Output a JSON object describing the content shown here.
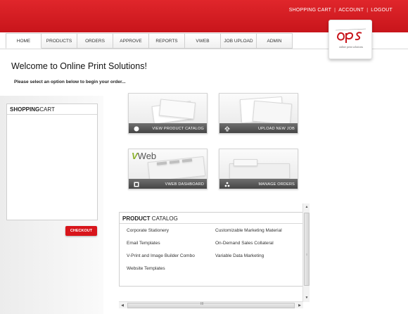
{
  "header": {
    "links": [
      "SHOPPING CART",
      "ACCOUNT",
      "LOGOUT"
    ],
    "brand_color": "#d8151b"
  },
  "nav": {
    "tabs": [
      "HOME",
      "PRODUCTS",
      "ORDERS",
      "APPROVE",
      "REPORTS",
      "VWEB",
      "JOB UPLOAD",
      "ADMIN"
    ],
    "active": "HOME"
  },
  "logo": {
    "mark": "ops",
    "tagline": "online print solutions"
  },
  "main": {
    "welcome": "Welcome to Online Print Solutions!",
    "instruction": "Please select an option below to begin your order..."
  },
  "sidebar": {
    "cart_title_bold": "SHOPPING",
    "cart_title_rest": "CART",
    "checkout_label": "CHECKOUT"
  },
  "tiles": [
    {
      "label": "VIEW PRODUCT CATALOG",
      "icon": "circle-icon"
    },
    {
      "label": "UPLOAD NEW JOB",
      "icon": "upload-icon"
    },
    {
      "label": "VWEB DASHBOARD",
      "icon": "dashboard-icon",
      "art_text": "Web",
      "art_prefix": "V"
    },
    {
      "label": "MANAGE ORDERS",
      "icon": "orders-icon"
    }
  ],
  "catalog": {
    "title_bold": "PRODUCT",
    "title_rest": "CATALOG",
    "items_left": [
      "Corporate Stationery",
      "Email Templates",
      "V-Print and Image Builder Combo",
      "Website Templates"
    ],
    "items_right": [
      "Customizable Marketing Material",
      "On-Demand Sales Collateral",
      "Variable Data Marketing"
    ]
  }
}
